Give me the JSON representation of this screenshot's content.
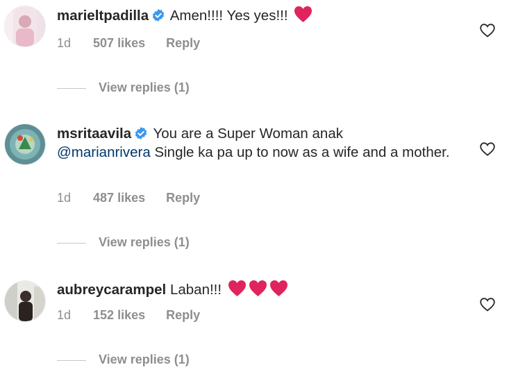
{
  "comments": [
    {
      "username": "marieltpadilla",
      "text": "Amen!!!! Yes yes!!!",
      "time": "1d",
      "likes": "507 likes",
      "reply": "Reply",
      "view_replies": "View replies (1)"
    },
    {
      "username": "msritaavila",
      "text": "You are a Super Woman anak",
      "mention": "@marianrivera",
      "text_after": "Single ka pa up to now as a wife and a mother.",
      "time": "1d",
      "likes": "487 likes",
      "reply": "Reply",
      "view_replies": "View replies (1)"
    },
    {
      "username": "aubreycarampel",
      "text": "Laban!!!",
      "time": "1d",
      "likes": "152 likes",
      "reply": "Reply",
      "view_replies": "View replies (1)"
    }
  ],
  "colors": {
    "verified": "#3897f0",
    "heart_emoji": "#e0245e",
    "mention": "#00376b",
    "muted": "#8e8e8e"
  },
  "icons": {
    "verified": "verified-badge-icon",
    "like": "heart-outline-icon",
    "emoji": "red-heart-emoji"
  }
}
